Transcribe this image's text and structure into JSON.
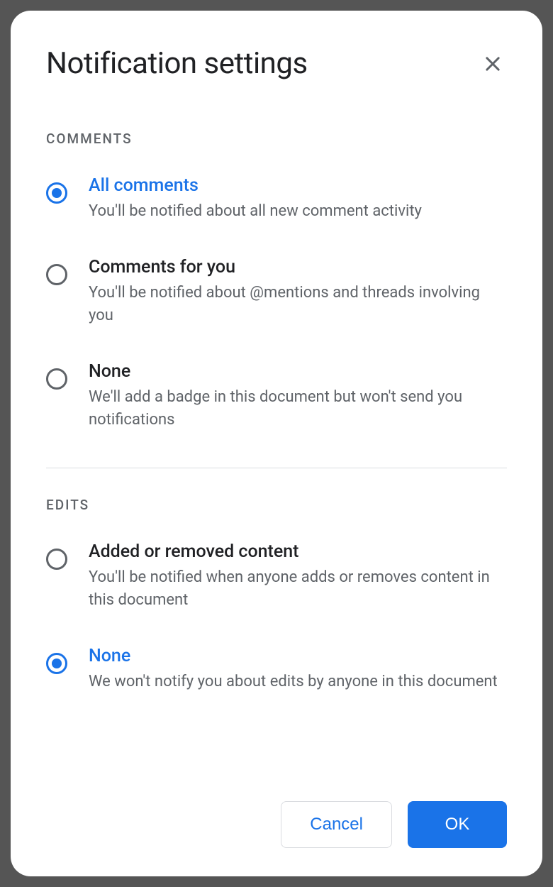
{
  "dialog": {
    "title": "Notification settings",
    "sections": {
      "comments": {
        "label": "COMMENTS",
        "options": [
          {
            "title": "All comments",
            "desc": "You'll be notified about all new comment activity",
            "selected": true
          },
          {
            "title": "Comments for you",
            "desc": "You'll be notified about @mentions and threads involving you",
            "selected": false
          },
          {
            "title": "None",
            "desc": "We'll add a badge in this document but won't send you notifications",
            "selected": false
          }
        ]
      },
      "edits": {
        "label": "EDITS",
        "options": [
          {
            "title": "Added or removed content",
            "desc": "You'll be notified when anyone adds or removes content in this document",
            "selected": false
          },
          {
            "title": "None",
            "desc": "We won't notify you about edits by anyone in this document",
            "selected": true
          }
        ]
      }
    },
    "buttons": {
      "cancel": "Cancel",
      "ok": "OK"
    }
  }
}
